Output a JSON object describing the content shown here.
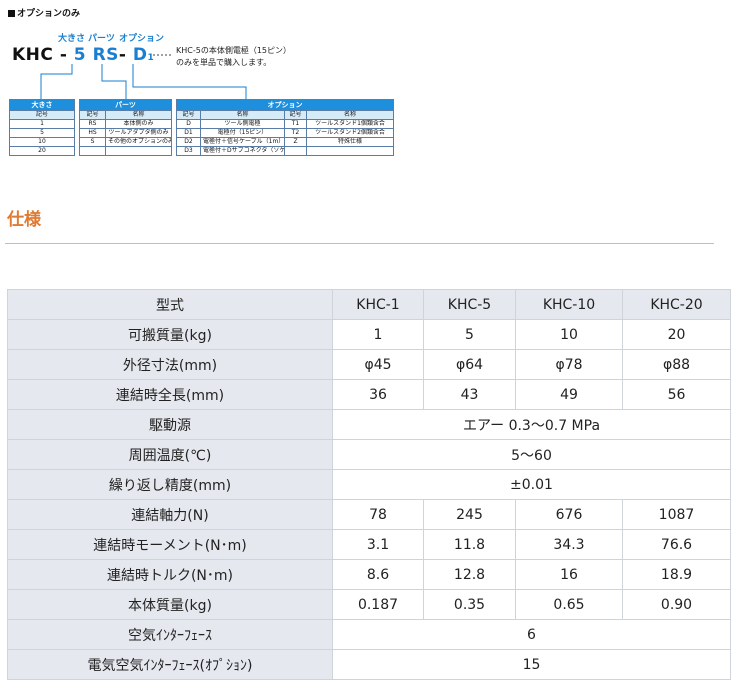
{
  "order_code": {
    "heading": "オプションのみ",
    "labels": {
      "size": "大きさ",
      "parts": "パーツ",
      "option": "オプション"
    },
    "code": {
      "model": "KHC",
      "sep": "-",
      "size": "5",
      "parts": "RS",
      "option": "D",
      "option_sub": "1"
    },
    "note": "KHC-5の本体側電極（15ピン）\nのみを単品で購入します。",
    "size_table": {
      "caption": "大きさ",
      "header": [
        "記号"
      ],
      "rows": [
        [
          "1"
        ],
        [
          "5"
        ],
        [
          "10"
        ],
        [
          "20"
        ]
      ]
    },
    "parts_table": {
      "caption": "パーツ",
      "header": [
        "記号",
        "名称"
      ],
      "rows": [
        [
          "RS",
          "本体側のみ"
        ],
        [
          "HS",
          "ツールアダプタ側のみ"
        ],
        [
          "S",
          "その他のオプションのみ"
        ],
        [
          "",
          ""
        ]
      ]
    },
    "option_table": {
      "caption": "オプション",
      "header": [
        "記号",
        "名称",
        "記号",
        "名称"
      ],
      "rows": [
        [
          "D",
          "ツール側電極",
          "T1",
          "ツールスタンド1個類含合"
        ],
        [
          "D1",
          "電極付（15ピン）",
          "T2",
          "ツールスタンド2個類含合"
        ],
        [
          "D2",
          "電極付＋信号ケーブル（1m）",
          "Z",
          "特殊仕様"
        ],
        [
          "D3",
          "電極付＋Dサブコネクタ（ソケット）",
          "",
          ""
        ]
      ]
    }
  },
  "section_title": "仕様",
  "spec_table": {
    "columns": [
      "型式",
      "KHC-1",
      "KHC-5",
      "KHC-10",
      "KHC-20"
    ],
    "rows": [
      {
        "label": "可搬質量(kg)",
        "values": [
          "1",
          "5",
          "10",
          "20"
        ]
      },
      {
        "label": "外径寸法(mm)",
        "values": [
          "φ45",
          "φ64",
          "φ78",
          "φ88"
        ]
      },
      {
        "label": "連結時全長(mm)",
        "values": [
          "36",
          "43",
          "49",
          "56"
        ]
      },
      {
        "label": "駆動源",
        "merged": "エアー 0.3～0.7 MPa"
      },
      {
        "label": "周囲温度(℃)",
        "merged": "5～60"
      },
      {
        "label": "繰り返し精度(mm)",
        "merged": "±0.01"
      },
      {
        "label": "連結軸力(N)",
        "values": [
          "78",
          "245",
          "676",
          "1087"
        ]
      },
      {
        "label": "連結時モーメント(N･m)",
        "values": [
          "3.1",
          "11.8",
          "34.3",
          "76.6"
        ]
      },
      {
        "label": "連結時トルク(N･m)",
        "values": [
          "8.6",
          "12.8",
          "16",
          "18.9"
        ]
      },
      {
        "label": "本体質量(kg)",
        "values": [
          "0.187",
          "0.35",
          "0.65",
          "0.90"
        ]
      },
      {
        "label": "空気ｲﾝﾀｰﾌｪｰｽ",
        "merged": "6"
      },
      {
        "label": "電気空気ｲﾝﾀｰﾌｪｰｽ(ｵﾌﾟｼｮﾝ)",
        "merged": "15"
      }
    ]
  }
}
